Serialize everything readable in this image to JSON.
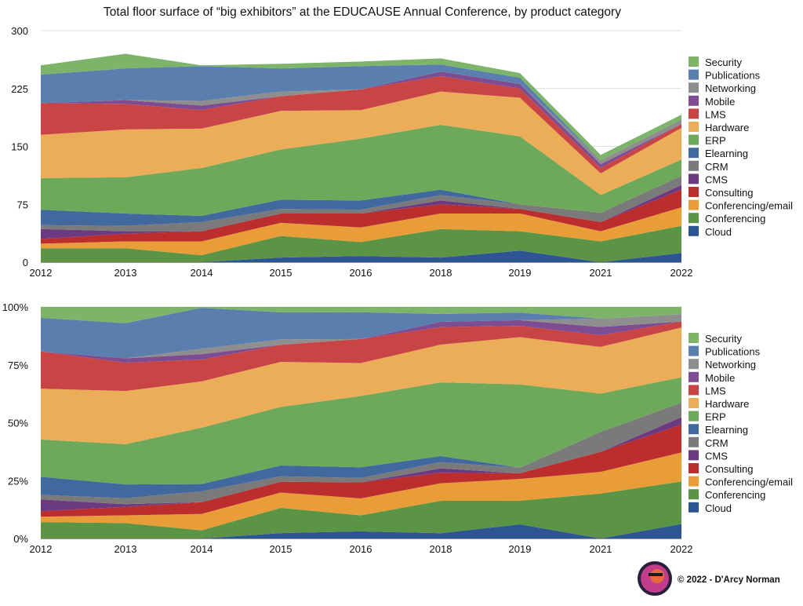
{
  "chart_data": [
    {
      "type": "area",
      "stacked": true,
      "title": "Total floor surface of “big exhibitors” at the EDUCAUSE Annual Conference, by product category",
      "categories": [
        "2012",
        "2013",
        "2014",
        "2015",
        "2016",
        "2018",
        "2019",
        "2021",
        "2022"
      ],
      "ylim": [
        0,
        300
      ],
      "yticks": [
        "0",
        "75",
        "150",
        "225",
        "300"
      ],
      "grid": true,
      "legend_position": "right",
      "series": [
        {
          "name": "Cloud",
          "color": "#2d5591",
          "values": [
            0,
            0,
            0,
            6,
            8,
            6,
            15,
            0,
            12
          ]
        },
        {
          "name": "Conferencing",
          "color": "#5b9445",
          "values": [
            18,
            18,
            9,
            28,
            18,
            37,
            25,
            27,
            35
          ]
        },
        {
          "name": "Conferencing/email",
          "color": "#e99d39",
          "values": [
            6,
            9,
            18,
            17,
            19,
            20,
            23,
            13,
            24
          ]
        },
        {
          "name": "Consulting",
          "color": "#bc2d2d",
          "values": [
            6,
            10,
            13,
            12,
            18,
            12,
            6,
            12,
            23
          ]
        },
        {
          "name": "CMS",
          "color": "#6c3a80",
          "values": [
            13,
            3,
            0,
            0,
            0,
            5,
            0,
            0,
            6
          ]
        },
        {
          "name": "CRM",
          "color": "#7a7a7a",
          "values": [
            5,
            7,
            12,
            6,
            5,
            7,
            6,
            12,
            12
          ]
        },
        {
          "name": "Elearning",
          "color": "#41699e",
          "values": [
            20,
            16,
            8,
            12,
            12,
            7,
            0,
            0,
            0
          ]
        },
        {
          "name": "ERP",
          "color": "#6ea85a",
          "values": [
            41,
            47,
            62,
            65,
            80,
            84,
            88,
            23,
            21
          ]
        },
        {
          "name": "Hardware",
          "color": "#ebad57",
          "values": [
            56,
            62,
            51,
            50,
            37,
            43,
            50,
            28,
            41
          ]
        },
        {
          "name": "LMS",
          "color": "#c94444",
          "values": [
            41,
            33,
            24,
            19,
            27,
            20,
            12,
            7,
            5
          ]
        },
        {
          "name": "Mobile",
          "color": "#7e4d91",
          "values": [
            0,
            5,
            6,
            0,
            0,
            6,
            6,
            5,
            0
          ]
        },
        {
          "name": "Networking",
          "color": "#8e8e8e",
          "values": [
            0,
            0,
            6,
            6,
            0,
            0,
            0,
            5,
            6
          ]
        },
        {
          "name": "Publications",
          "color": "#5a7fae",
          "values": [
            37,
            41,
            45,
            30,
            30,
            9,
            8,
            0,
            0
          ]
        },
        {
          "name": "Security",
          "color": "#7cb46a",
          "values": [
            12,
            19,
            1,
            6,
            6,
            8,
            6,
            7,
            6
          ]
        }
      ]
    },
    {
      "type": "area",
      "stacked": true,
      "normalized": "percent",
      "title": "",
      "categories": [
        "2012",
        "2013",
        "2014",
        "2015",
        "2016",
        "2018",
        "2019",
        "2021",
        "2022"
      ],
      "ylim": [
        0,
        100
      ],
      "yticks": [
        "0%",
        "25%",
        "50%",
        "75%",
        "100%"
      ],
      "grid": true,
      "legend_position": "right",
      "series_source": "same series as chart 1, each expressed as percent of year total"
    }
  ],
  "footer": {
    "copyright": "© 2022 - D'Arcy Norman"
  }
}
